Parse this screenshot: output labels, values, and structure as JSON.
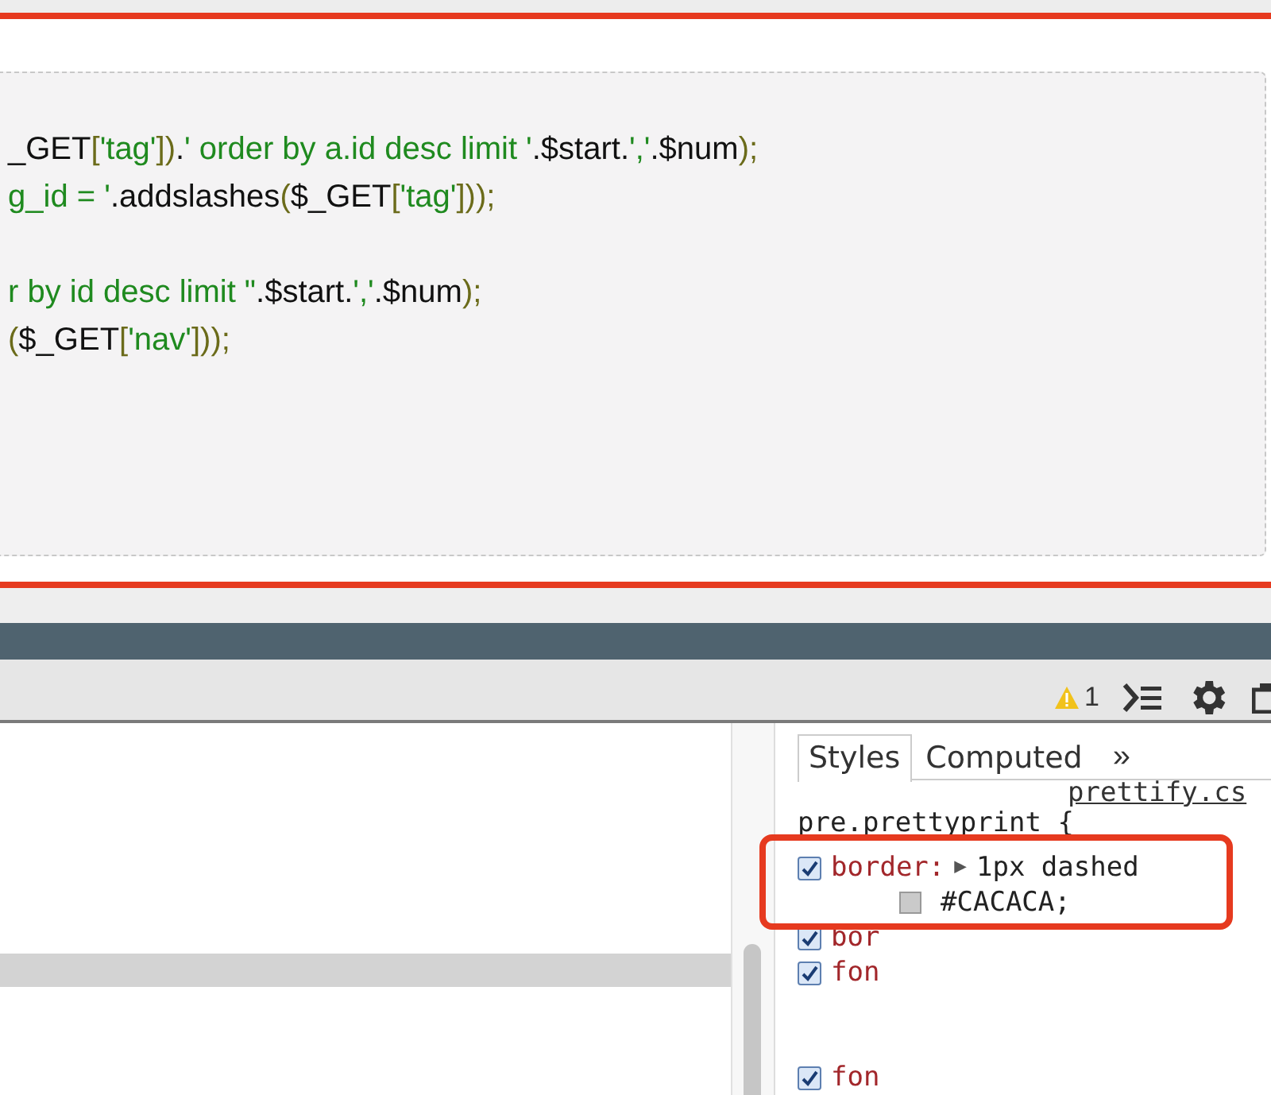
{
  "code_block": {
    "lines": [
      {
        "segments": [
          {
            "kind": "pln",
            "text": "_GET"
          },
          {
            "kind": "pun",
            "text": "["
          },
          {
            "kind": "str",
            "text": "'tag'"
          },
          {
            "kind": "pun",
            "text": "])"
          },
          {
            "kind": "pln",
            "text": "."
          },
          {
            "kind": "str",
            "text": "' order by a.id desc limit '"
          },
          {
            "kind": "pln",
            "text": ".$start."
          },
          {
            "kind": "str",
            "text": "','"
          },
          {
            "kind": "pln",
            "text": ".$num"
          },
          {
            "kind": "pun",
            "text": ");"
          }
        ]
      },
      {
        "segments": [
          {
            "kind": "str",
            "text": "g_id = '"
          },
          {
            "kind": "pln",
            "text": ".addslashes"
          },
          {
            "kind": "pun",
            "text": "("
          },
          {
            "kind": "pln",
            "text": "$_GET"
          },
          {
            "kind": "pun",
            "text": "["
          },
          {
            "kind": "str",
            "text": "'tag'"
          },
          {
            "kind": "pun",
            "text": "]));"
          }
        ]
      },
      {
        "blank_before": true,
        "segments": [
          {
            "kind": "str",
            "text": "r by id desc limit \""
          },
          {
            "kind": "pln",
            "text": ".$start."
          },
          {
            "kind": "str",
            "text": "','"
          },
          {
            "kind": "pln",
            "text": ".$num"
          },
          {
            "kind": "pun",
            "text": ");"
          }
        ]
      },
      {
        "segments": [
          {
            "kind": "pun",
            "text": "("
          },
          {
            "kind": "pln",
            "text": "$_GET"
          },
          {
            "kind": "pun",
            "text": "["
          },
          {
            "kind": "str",
            "text": "'nav'"
          },
          {
            "kind": "pun",
            "text": "]));"
          }
        ]
      }
    ]
  },
  "toolbar": {
    "warning_count": "1"
  },
  "sidebar": {
    "tabs": [
      {
        "label": "Styles",
        "selected": true
      },
      {
        "label": "Computed",
        "selected": false
      }
    ],
    "more": "»"
  },
  "styles": {
    "source_link": "prettify.cs",
    "selector": "pre.prettyprint {",
    "properties": [
      {
        "checked": true,
        "name": "border:",
        "expander": "▶",
        "value": "1px dashed",
        "value2": "#CACACA;"
      },
      {
        "checked": true,
        "name": "bor"
      },
      {
        "checked": true,
        "name": "fon"
      },
      {
        "checked": true,
        "name": "fon",
        "gap": true
      }
    ]
  }
}
